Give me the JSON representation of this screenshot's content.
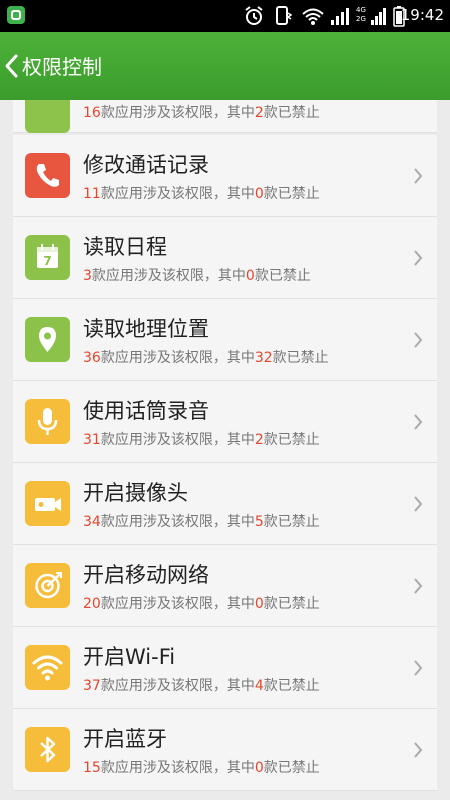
{
  "status": {
    "time": "19:42",
    "network_label": "4G 2G",
    "app_badge_color": "#3fb04b"
  },
  "header": {
    "title": "权限控制",
    "background": "#44a632"
  },
  "permissions": [
    {
      "name": "",
      "total": "16",
      "total_suffix": "款应用涉及该权限，其中",
      "blocked": "2",
      "blocked_suffix": "款已禁止",
      "icon": "partial-icon",
      "color": "#8dc34a"
    },
    {
      "name": "修改通话记录",
      "total": "11",
      "total_suffix": "款应用涉及该权限，其中",
      "blocked": "0",
      "blocked_suffix": "款已禁止",
      "icon": "phone-icon",
      "color": "#e8563f"
    },
    {
      "name": "读取日程",
      "total": "3",
      "total_suffix": "款应用涉及该权限，其中",
      "blocked": "0",
      "blocked_suffix": "款已禁止",
      "icon": "calendar-icon",
      "color": "#8cc24a"
    },
    {
      "name": "读取地理位置",
      "total": "36",
      "total_suffix": "款应用涉及该权限，其中",
      "blocked": "32",
      "blocked_suffix": "款已禁止",
      "icon": "location-pin-icon",
      "color": "#8cc24a"
    },
    {
      "name": "使用话筒录音",
      "total": "31",
      "total_suffix": "款应用涉及该权限，其中",
      "blocked": "2",
      "blocked_suffix": "款已禁止",
      "icon": "microphone-icon",
      "color": "#f5bd3a"
    },
    {
      "name": "开启摄像头",
      "total": "34",
      "total_suffix": "款应用涉及该权限，其中",
      "blocked": "5",
      "blocked_suffix": "款已禁止",
      "icon": "camera-icon",
      "color": "#f5bd3a"
    },
    {
      "name": "开启移动网络",
      "total": "20",
      "total_suffix": "款应用涉及该权限，其中",
      "blocked": "0",
      "blocked_suffix": "款已禁止",
      "icon": "mobile-network-icon",
      "color": "#f5bd3a"
    },
    {
      "name": "开启Wi-Fi",
      "total": "37",
      "total_suffix": "款应用涉及该权限，其中",
      "blocked": "4",
      "blocked_suffix": "款已禁止",
      "icon": "wifi-icon",
      "color": "#f5bd3a"
    },
    {
      "name": "开启蓝牙",
      "total": "15",
      "total_suffix": "款应用涉及该权限，其中",
      "blocked": "0",
      "blocked_suffix": "款已禁止",
      "icon": "bluetooth-icon",
      "color": "#f5bd3a"
    }
  ]
}
